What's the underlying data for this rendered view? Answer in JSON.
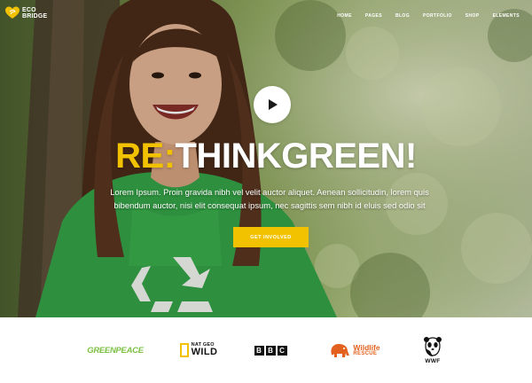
{
  "brand": {
    "name_line1": "ECO",
    "name_line2": "BRIDGE",
    "logo_icon": "heart-leaf-icon",
    "accent_color": "#f2c200"
  },
  "nav": {
    "items": [
      "HOME",
      "PAGES",
      "BLOG",
      "PORTFOLIO",
      "SHOP",
      "ELEMENTS"
    ]
  },
  "hero": {
    "play_icon": "play-icon",
    "headline_accent": "RE:",
    "headline_main": "THINKGREEN!",
    "intro": "Lorem Ipsum. Proin gravida nibh vel velit auctor aliquet. Aenean sollicitudin, lorem quis bibendum auctor, nisi elit consequat ipsum, nec sagittis sem nibh id eluis sed odio sit",
    "cta": "GET INVOLVED"
  },
  "partners": {
    "greenpeace": "GREENPEACE",
    "natgeo_top": "NAT GEO",
    "natgeo_bottom": "WILD",
    "bbc_letters": [
      "B",
      "B",
      "C"
    ],
    "wildlife_top": "Wildlife",
    "wildlife_bottom": "RESCUE",
    "wwf": "WWF"
  },
  "colors": {
    "greenpeace": "#7cc043",
    "wildlife": "#e2611f",
    "shirt": "#35a447"
  }
}
